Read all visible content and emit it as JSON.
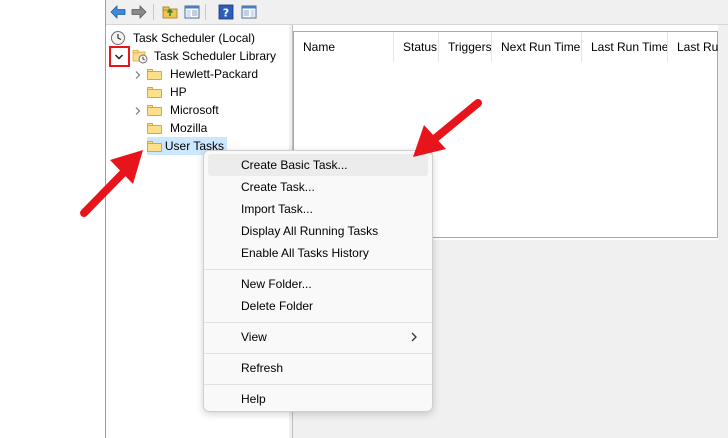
{
  "toolbar": {
    "icons": [
      "back-arrow-icon",
      "forward-arrow-icon",
      "up-folder-icon",
      "show-hide-console-tree-icon",
      "help-icon",
      "show-hide-action-pane-icon"
    ]
  },
  "tree": {
    "root_label": "Task Scheduler (Local)",
    "library_label": "Task Scheduler Library",
    "folders": [
      {
        "label": "Hewlett-Packard",
        "expandable": true
      },
      {
        "label": "HP",
        "expandable": false
      },
      {
        "label": "Microsoft",
        "expandable": true
      },
      {
        "label": "Mozilla",
        "expandable": false
      },
      {
        "label": "User Tasks",
        "expandable": false,
        "selected": true
      }
    ]
  },
  "list": {
    "columns": [
      "Name",
      "Status",
      "Triggers",
      "Next Run Time",
      "Last Run Time",
      "Last Run"
    ]
  },
  "context_menu": {
    "items": [
      {
        "label": "Create Basic Task..."
      },
      {
        "label": "Create Task..."
      },
      {
        "label": "Import Task..."
      },
      {
        "label": "Display All Running Tasks"
      },
      {
        "label": "Enable All Tasks History"
      },
      {
        "label": "New Folder..."
      },
      {
        "label": "Delete Folder"
      },
      {
        "label": "View"
      },
      {
        "label": "Refresh"
      },
      {
        "label": "Help"
      }
    ]
  },
  "colors": {
    "highlight_red": "#e8141c",
    "selection_blue": "#cce8ff",
    "folder_yellow": "#ffe08a"
  }
}
